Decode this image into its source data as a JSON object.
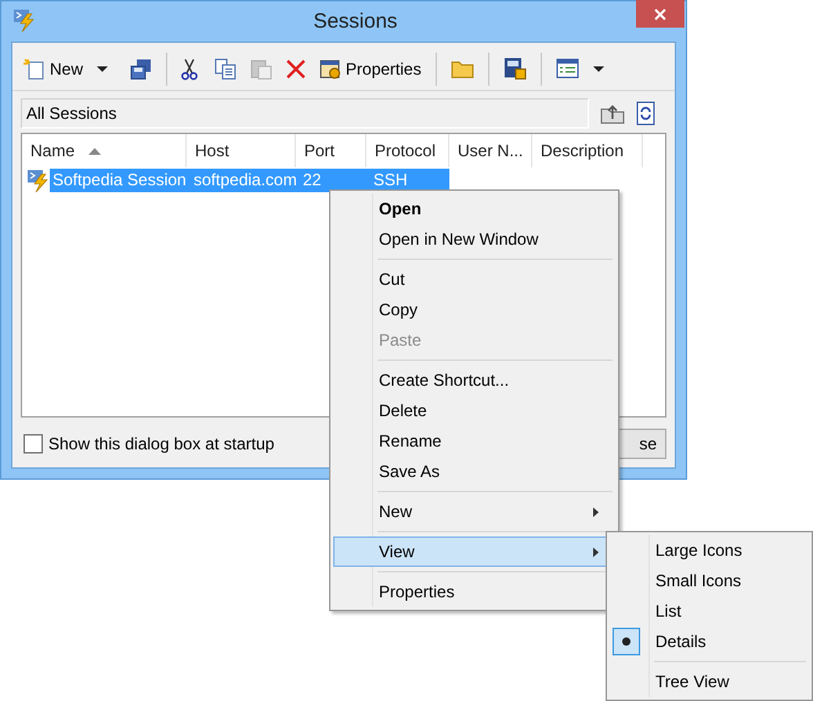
{
  "window": {
    "title": "Sessions"
  },
  "toolbar": [
    {
      "kind": "new",
      "label": "New",
      "disabled": false
    },
    {
      "kind": "dropdown",
      "disabled": false
    },
    {
      "kind": "save",
      "disabled": false
    },
    {
      "kind": "separator"
    },
    {
      "kind": "cut",
      "disabled": false
    },
    {
      "kind": "copy",
      "disabled": false
    },
    {
      "kind": "paste",
      "disabled": true
    },
    {
      "kind": "delete",
      "disabled": false
    },
    {
      "kind": "properties",
      "label": "Properties",
      "disabled": false
    },
    {
      "kind": "separator"
    },
    {
      "kind": "folder",
      "disabled": false
    },
    {
      "kind": "separator"
    },
    {
      "kind": "terminal",
      "disabled": false
    },
    {
      "kind": "separator"
    },
    {
      "kind": "view",
      "disabled": false
    },
    {
      "kind": "dropdown",
      "disabled": false
    }
  ],
  "address": {
    "path": "All Sessions"
  },
  "table": {
    "columns": [
      {
        "label": "Name",
        "sorted": true
      },
      {
        "label": "Host",
        "sorted": false
      },
      {
        "label": "Port",
        "sorted": false
      },
      {
        "label": "Protocol",
        "sorted": false
      },
      {
        "label": "User N...",
        "sorted": false
      },
      {
        "label": "Description",
        "sorted": false
      }
    ],
    "rows": [
      {
        "cells": [
          "Softpedia Session",
          "softpedia.com",
          "22",
          "SSH"
        ],
        "selected": true
      }
    ]
  },
  "startup_checkbox": {
    "label": "Show this dialog box at startup",
    "checked": false
  },
  "close_button": {
    "label": "se"
  },
  "context_menu": [
    {
      "kind": "item",
      "label": "Open",
      "bold": true,
      "disabled": false,
      "submenu": false,
      "selected": false
    },
    {
      "kind": "item",
      "label": "Open in New Window",
      "bold": false,
      "disabled": false,
      "submenu": false,
      "selected": false
    },
    {
      "kind": "separator"
    },
    {
      "kind": "item",
      "label": "Cut",
      "bold": false,
      "disabled": false,
      "submenu": false,
      "selected": false
    },
    {
      "kind": "item",
      "label": "Copy",
      "bold": false,
      "disabled": false,
      "submenu": false,
      "selected": false
    },
    {
      "kind": "item",
      "label": "Paste",
      "bold": false,
      "disabled": true,
      "submenu": false,
      "selected": false
    },
    {
      "kind": "separator"
    },
    {
      "kind": "item",
      "label": "Create Shortcut...",
      "bold": false,
      "disabled": false,
      "submenu": false,
      "selected": false
    },
    {
      "kind": "item",
      "label": "Delete",
      "bold": false,
      "disabled": false,
      "submenu": false,
      "selected": false
    },
    {
      "kind": "item",
      "label": "Rename",
      "bold": false,
      "disabled": false,
      "submenu": false,
      "selected": false
    },
    {
      "kind": "item",
      "label": "Save As",
      "bold": false,
      "disabled": false,
      "submenu": false,
      "selected": false
    },
    {
      "kind": "separator"
    },
    {
      "kind": "item",
      "label": "New",
      "bold": false,
      "disabled": false,
      "submenu": true,
      "selected": false
    },
    {
      "kind": "separator"
    },
    {
      "kind": "item",
      "label": "View",
      "bold": false,
      "disabled": false,
      "submenu": true,
      "selected": true
    },
    {
      "kind": "separator"
    },
    {
      "kind": "item",
      "label": "Properties",
      "bold": false,
      "disabled": false,
      "submenu": false,
      "selected": false
    }
  ],
  "view_submenu": [
    {
      "kind": "item",
      "label": "Large Icons",
      "checked": false
    },
    {
      "kind": "item",
      "label": "Small Icons",
      "checked": false
    },
    {
      "kind": "item",
      "label": "List",
      "checked": false
    },
    {
      "kind": "item",
      "label": "Details",
      "checked": true
    },
    {
      "kind": "separator"
    },
    {
      "kind": "item",
      "label": "Tree View",
      "checked": false
    }
  ]
}
